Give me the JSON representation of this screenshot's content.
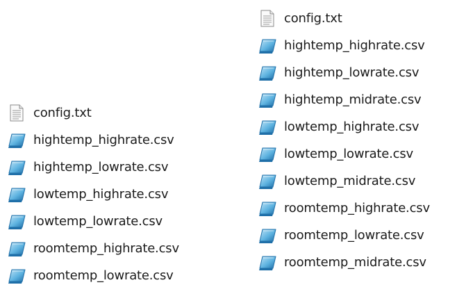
{
  "icons": {
    "text": "text-file-icon",
    "csv": "csv-file-icon"
  },
  "colors": {
    "csv_light": "#bfe3f6",
    "csv_mid": "#5eb3e0",
    "csv_dark": "#1f6fa8",
    "txt_border": "#8a8a8a"
  },
  "left_folder": {
    "files": [
      {
        "name": "config.txt",
        "type": "text"
      },
      {
        "name": "hightemp_highrate.csv",
        "type": "csv"
      },
      {
        "name": "hightemp_lowrate.csv",
        "type": "csv"
      },
      {
        "name": "lowtemp_highrate.csv",
        "type": "csv"
      },
      {
        "name": "lowtemp_lowrate.csv",
        "type": "csv"
      },
      {
        "name": "roomtemp_highrate.csv",
        "type": "csv"
      },
      {
        "name": "roomtemp_lowrate.csv",
        "type": "csv"
      }
    ]
  },
  "right_folder": {
    "files": [
      {
        "name": "config.txt",
        "type": "text"
      },
      {
        "name": "hightemp_highrate.csv",
        "type": "csv"
      },
      {
        "name": "hightemp_lowrate.csv",
        "type": "csv"
      },
      {
        "name": "hightemp_midrate.csv",
        "type": "csv"
      },
      {
        "name": "lowtemp_highrate.csv",
        "type": "csv"
      },
      {
        "name": "lowtemp_lowrate.csv",
        "type": "csv"
      },
      {
        "name": "lowtemp_midrate.csv",
        "type": "csv"
      },
      {
        "name": "roomtemp_highrate.csv",
        "type": "csv"
      },
      {
        "name": "roomtemp_lowrate.csv",
        "type": "csv"
      },
      {
        "name": "roomtemp_midrate.csv",
        "type": "csv"
      }
    ]
  }
}
